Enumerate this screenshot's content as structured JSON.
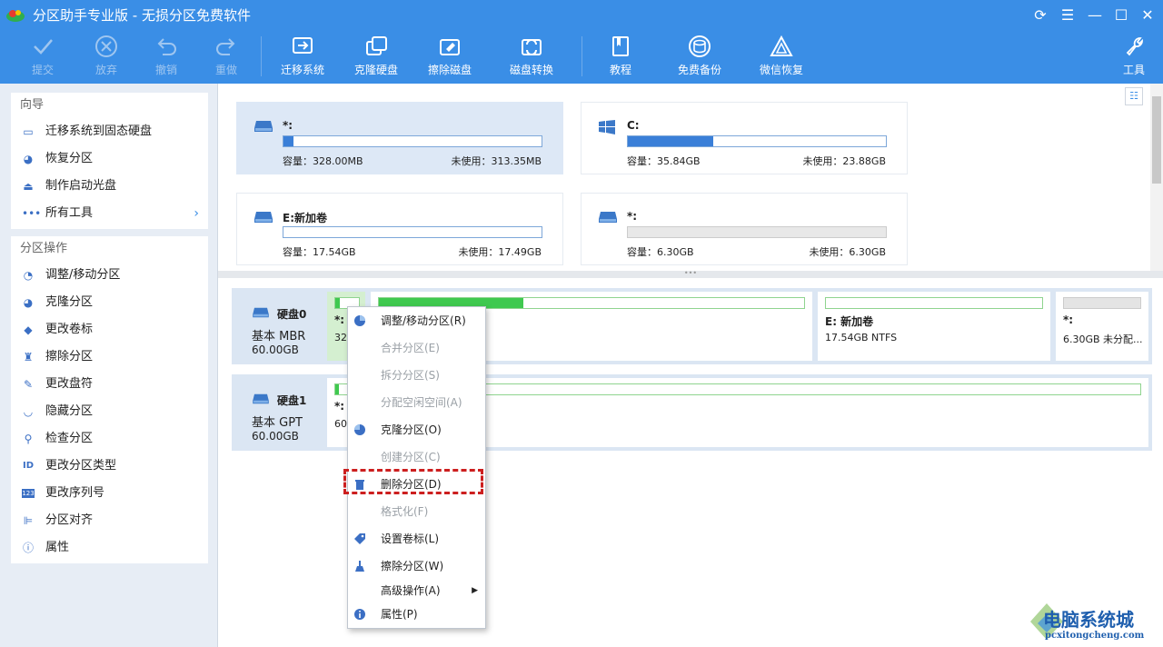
{
  "app": {
    "title": "分区助手专业版 - 无损分区免费软件",
    "window_controls": [
      "refresh-icon",
      "menu-icon",
      "minimize-icon",
      "maximize-icon",
      "close-icon"
    ]
  },
  "toolbar": {
    "commit": "提交",
    "discard": "放弃",
    "undo": "撤销",
    "redo": "重做",
    "migrate": "迁移系统",
    "clone": "克隆硬盘",
    "wipe": "擦除磁盘",
    "convert": "磁盘转换",
    "tutorial": "教程",
    "backup": "免费备份",
    "wechat": "微信恢复",
    "tools": "工具"
  },
  "sidebar": {
    "wizard_title": "向导",
    "wizard_items": [
      {
        "label": "迁移系统到固态硬盘",
        "icon": "migrate-icon"
      },
      {
        "label": "恢复分区",
        "icon": "restore-icon"
      },
      {
        "label": "制作启动光盘",
        "icon": "bootdisk-icon"
      },
      {
        "label": "所有工具",
        "icon": "more-icon"
      }
    ],
    "ops_title": "分区操作",
    "ops_items": [
      {
        "label": "调整/移动分区",
        "icon": "resize-icon"
      },
      {
        "label": "克隆分区",
        "icon": "clone-icon"
      },
      {
        "label": "更改卷标",
        "icon": "tag-icon"
      },
      {
        "label": "擦除分区",
        "icon": "wipe-icon"
      },
      {
        "label": "更改盘符",
        "icon": "pencil-icon"
      },
      {
        "label": "隐藏分区",
        "icon": "hide-icon"
      },
      {
        "label": "检查分区",
        "icon": "check-icon"
      },
      {
        "label": "更改分区类型",
        "icon": "id-icon"
      },
      {
        "label": "更改序列号",
        "icon": "serial-icon"
      },
      {
        "label": "分区对齐",
        "icon": "align-icon"
      },
      {
        "label": "属性",
        "icon": "info-icon"
      }
    ]
  },
  "volumes": [
    {
      "name": "*:",
      "capacity": "容量：328.00MB",
      "free": "未使用：313.35MB",
      "used_fraction": 0.04,
      "selected": true
    },
    {
      "name": "C:",
      "capacity": "容量：35.84GB",
      "free": "未使用：23.88GB",
      "used_fraction": 0.33,
      "selected": false
    },
    {
      "name": "E:新加卷",
      "capacity": "容量：17.54GB",
      "free": "未使用：17.49GB",
      "used_fraction": 0.0,
      "selected": false
    },
    {
      "name": "*:",
      "capacity": "容量：6.30GB",
      "free": "未使用：6.30GB",
      "used_fraction": 0.0,
      "selected": false
    }
  ],
  "disks": [
    {
      "name": "硬盘0",
      "type": "基本 MBR",
      "size": "60.00GB",
      "partitions": [
        {
          "label": "*:",
          "detail": "32",
          "used_fraction": 0.2
        },
        {
          "label": "",
          "detail": "",
          "used_fraction": 0.34
        },
        {
          "label": "E: 新加卷",
          "detail": "17.54GB NTFS",
          "used_fraction": 0.0
        },
        {
          "label": "*:",
          "detail": "6.30GB 未分配...",
          "used_fraction": 0.0
        }
      ]
    },
    {
      "name": "硬盘1",
      "type": "基本 GPT",
      "size": "60.00GB",
      "partitions": [
        {
          "label": "*:",
          "detail": "60",
          "used_fraction": 0.005
        }
      ]
    }
  ],
  "context_menu": [
    {
      "label": "调整/移动分区(R)",
      "enabled": true,
      "icon": "resize-icon"
    },
    {
      "label": "合并分区(E)",
      "enabled": false
    },
    {
      "label": "拆分分区(S)",
      "enabled": false
    },
    {
      "label": "分配空闲空间(A)",
      "enabled": false
    },
    {
      "label": "克隆分区(O)",
      "enabled": true,
      "icon": "clone-icon"
    },
    {
      "label": "创建分区(C)",
      "enabled": false
    },
    {
      "label": "删除分区(D)",
      "enabled": true,
      "icon": "delete-icon",
      "highlighted": true
    },
    {
      "label": "格式化(F)",
      "enabled": false
    },
    {
      "label": "设置卷标(L)",
      "enabled": true,
      "icon": "tag-icon"
    },
    {
      "label": "擦除分区(W)",
      "enabled": true,
      "icon": "wipe-icon"
    },
    {
      "label": "高级操作(A)",
      "enabled": true,
      "submenu": true
    },
    {
      "label": "属性(P)",
      "enabled": true,
      "icon": "info-icon"
    }
  ],
  "watermark": {
    "title": "电脑系统城",
    "url": "pcxitongcheng.com"
  },
  "colors": {
    "accent": "#3a8ee6",
    "highlight_border": "#cc1f1f",
    "used_bar": "#3fc94f",
    "volume_bar": "#3a7fd8"
  }
}
